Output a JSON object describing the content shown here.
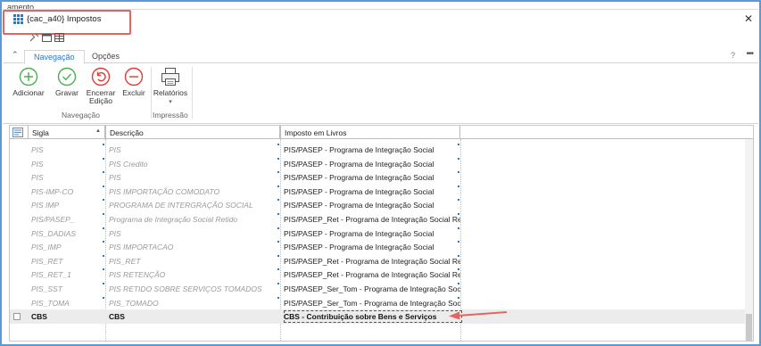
{
  "background_title": "amento",
  "window": {
    "title": "{cac_a40} Impostos",
    "close_label": "✕"
  },
  "tabs": {
    "collapse_label": "⌃",
    "items": [
      {
        "label": "Navegação",
        "active": true
      },
      {
        "label": "Opções",
        "active": false
      }
    ],
    "help_label": "?",
    "more_label": "•••"
  },
  "ribbon": {
    "buttons": {
      "adicionar": "Adicionar",
      "gravar": "Gravar",
      "encerrar_l1": "Encerrar",
      "encerrar_l2": "Edição",
      "excluir": "Excluir",
      "relatorios": "Relatórios",
      "relatorios_caret": "▾"
    },
    "groups": {
      "navegacao": "Navegação",
      "impressao": "Impressão"
    }
  },
  "grid": {
    "columns": [
      "Sigla",
      "Descrição",
      "Imposto em Livros"
    ],
    "sort_indicator": "▲",
    "rows": [
      {
        "sigla": "PIS",
        "descricao": "PIS",
        "imposto": "PIS/PASEP - Programa de Integração Social"
      },
      {
        "sigla": "PIS",
        "descricao": "PIS Credito",
        "imposto": "PIS/PASEP - Programa de Integração Social"
      },
      {
        "sigla": "PIS",
        "descricao": "PIS",
        "imposto": "PIS/PASEP - Programa de Integração Social"
      },
      {
        "sigla": "PIS-IMP-CO",
        "descricao": "PIS IMPORTAÇÃO COMODATO",
        "imposto": "PIS/PASEP - Programa de Integração Social"
      },
      {
        "sigla": "PIS IMP",
        "descricao": "PROGRAMA DE INTERGRAÇÃO SOCIAL",
        "imposto": "PIS/PASEP - Programa de Integração Social"
      },
      {
        "sigla": "PIS/PASEP_",
        "descricao": "Programa de Integração Social Retido",
        "imposto": "PIS/PASEP_Ret - Programa de Integração Social Retido"
      },
      {
        "sigla": "PIS_DADIAS",
        "descricao": "PIS",
        "imposto": "PIS/PASEP - Programa de Integração Social"
      },
      {
        "sigla": "PIS_IMP",
        "descricao": "PIS IMPORTACAO",
        "imposto": "PIS/PASEP - Programa de Integração Social"
      },
      {
        "sigla": "PIS_RET",
        "descricao": "PIS_RET",
        "imposto": "PIS/PASEP_Ret - Programa de Integração Social Retido"
      },
      {
        "sigla": "PIS_RET_1",
        "descricao": "PIS RETENÇÃO",
        "imposto": "PIS/PASEP_Ret - Programa de Integração Social Retido"
      },
      {
        "sigla": "PIS_SST",
        "descricao": "PIS RETIDO SOBRE SERVIÇOS TOMADOS",
        "imposto": "PIS/PASEP_Ser_Tom - Programa de Integração Social"
      },
      {
        "sigla": "PIS_TOMA",
        "descricao": "PIS_TOMADO",
        "imposto": "PIS/PASEP_Ser_Tom - Programa de Integração Social"
      }
    ],
    "selected_row": {
      "sigla": "CBS",
      "descricao": "CBS",
      "imposto": "CBS - Contribuição sobre Bens e Serviços"
    }
  },
  "colors": {
    "accent": "#2b78c5",
    "highlight_red": "#e06666",
    "green": "#4caf50",
    "red": "#e53935"
  }
}
